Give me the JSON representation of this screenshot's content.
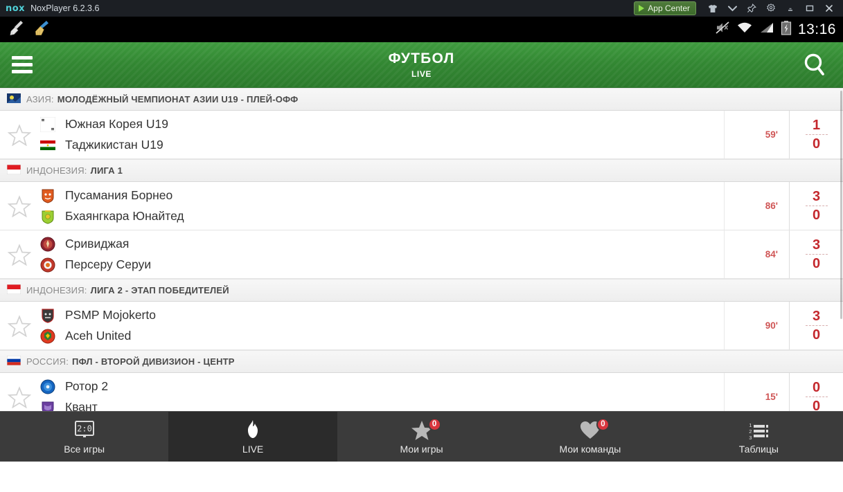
{
  "window": {
    "logo": "nox-logo",
    "title": "NoxPlayer 6.2.3.6",
    "app_center_label": "App Center",
    "controls": [
      "shirt-icon",
      "chevron-down-icon",
      "pin-icon",
      "gear-icon",
      "minimize-icon",
      "maximize-icon",
      "close-icon"
    ]
  },
  "statusbar": {
    "left_icons": [
      "broom-grey-icon",
      "broom-blue-icon"
    ],
    "right_icons": [
      "mute-icon",
      "wifi-icon",
      "signal-icon",
      "battery-charging-icon"
    ],
    "clock": "13:16"
  },
  "appbar": {
    "menu": "hamburger-icon",
    "title": "ФУТБОЛ",
    "subtitle": "LIVE",
    "search": "search-icon",
    "accent_color": "#338833"
  },
  "list": [
    {
      "type": "league",
      "flag": "afc-flag",
      "country": "АЗИЯ:",
      "name": "МОЛОДЁЖНЫЙ ЧЕМПИОНАТ АЗИИ U19 - ПЛЕЙ-ОФФ"
    },
    {
      "type": "match",
      "star": "star-outline-icon",
      "home": {
        "crest": "south-korea-flag",
        "name": "Южная Корея U19",
        "score": "1"
      },
      "away": {
        "crest": "tajikistan-flag",
        "name": "Таджикистан U19",
        "score": "0"
      },
      "minute": "59'"
    },
    {
      "type": "league",
      "flag": "indonesia-flag",
      "country": "ИНДОНЕЗИЯ:",
      "name": "ЛИГА 1"
    },
    {
      "type": "match",
      "star": "star-outline-icon",
      "home": {
        "crest": "pusamania-borneo-crest",
        "name": "Пусамания Борнео",
        "score": "3"
      },
      "away": {
        "crest": "bhayangkara-united-crest",
        "name": "Бхаянгкара Юнайтед",
        "score": "0"
      },
      "minute": "86'"
    },
    {
      "type": "match",
      "star": "star-outline-icon",
      "home": {
        "crest": "sriwijaya-crest",
        "name": "Сривиджая",
        "score": "3"
      },
      "away": {
        "crest": "perseru-serui-crest",
        "name": "Персеру Серуи",
        "score": "0"
      },
      "minute": "84'"
    },
    {
      "type": "league",
      "flag": "indonesia-flag",
      "country": "ИНДОНЕЗИЯ:",
      "name": "ЛИГА 2 - ЭТАП ПОБЕДИТЕЛЕЙ"
    },
    {
      "type": "match",
      "star": "star-outline-icon",
      "home": {
        "crest": "psmp-mojokerto-crest",
        "name": "PSMP Mojokerto",
        "score": "3"
      },
      "away": {
        "crest": "aceh-united-crest",
        "name": "Aceh United",
        "score": "0"
      },
      "minute": "90'"
    },
    {
      "type": "league",
      "flag": "russia-flag",
      "country": "РОССИЯ:",
      "name": "ПФЛ - ВТОРОЙ ДИВИЗИОН - ЦЕНТР"
    },
    {
      "type": "match",
      "star": "star-outline-icon",
      "home": {
        "crest": "rotor-2-crest",
        "name": "Ротор 2",
        "score": "0"
      },
      "away": {
        "crest": "kvant-crest",
        "name": "Квант",
        "score": "0"
      },
      "minute": "15'"
    }
  ],
  "bottomnav": [
    {
      "icon": "scoreboard-icon",
      "label": "Все игры",
      "badge": null,
      "active": false
    },
    {
      "icon": "flame-icon",
      "label": "LIVE",
      "badge": null,
      "active": true
    },
    {
      "icon": "star-icon",
      "label": "Мои игры",
      "badge": "0",
      "active": false
    },
    {
      "icon": "heart-icon",
      "label": "Мои команды",
      "badge": "0",
      "active": false
    },
    {
      "icon": "table-list-icon",
      "label": "Таблицы",
      "badge": null,
      "active": false
    }
  ]
}
